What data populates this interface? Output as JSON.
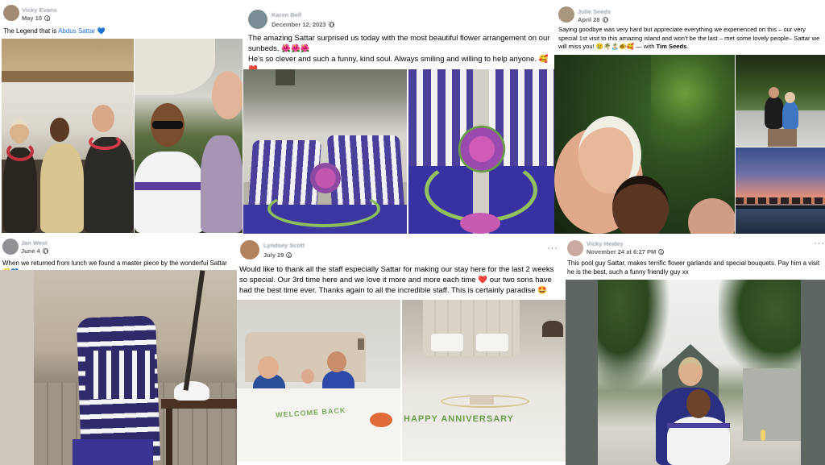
{
  "posts": [
    {
      "author": "Vicky Evans",
      "date": "May 10",
      "caption_prefix": "The Legend that is ",
      "caption_mention": "Abdus Sattar",
      "caption_suffix": " 💙"
    },
    {
      "author": "Karen Bell",
      "date": "December 12, 2023",
      "caption": "The amazing Sattar surprised us today with the most beautiful flower arrangement on our sunbeds. 🌺🌺🌺\nHe's so clever and such a funny, kind soul. Always smiling and willing to help anyone. 🥰❤️"
    },
    {
      "author": "Julie Seeds",
      "date": "April 28",
      "caption_main": "Saying goodbye was very hard but appreciate everything we experienced on this – our very special 1st visit to this amazing island and won't be the last – met some lovely people– Sattar we will miss you! 😢🌴🏝️🐠🥰 — with ",
      "caption_with": "Tim Seeds",
      "caption_end": "."
    },
    {
      "author": "Jan West",
      "date": "June 4",
      "caption": "When we returned from lunch we found a master piece by the wonderful Sattar 💛💙"
    },
    {
      "author": "Lyndsey Scott",
      "date": "July 29",
      "caption": "Would like to thank all the staff especially Sattar for making our stay here for the last 2 weeks so special. Our 3rd time here and we love it more and more each time ❤️ our two sons have had the best time ever. Thanks again to all the incredible staff. This is certainly paradise 🤩",
      "bed_text_welcome": "WELCOME BACK",
      "bed_text_anniversary": "HAPPY ANNIVERSARY"
    },
    {
      "author": "Vicky Healey",
      "date": "November 24 at 6:27 PM",
      "caption": "This pool guy Sattar, makes terrific flower garlands and special bouquets. Pay him a visit he is the best, such a funny friendly guy xx"
    }
  ],
  "more_label": "···",
  "colors": {
    "name_blur": "#9aa1ab",
    "date": "#65676b",
    "mention": "#216fdb",
    "stripe_purple": "#4a3f9a"
  }
}
